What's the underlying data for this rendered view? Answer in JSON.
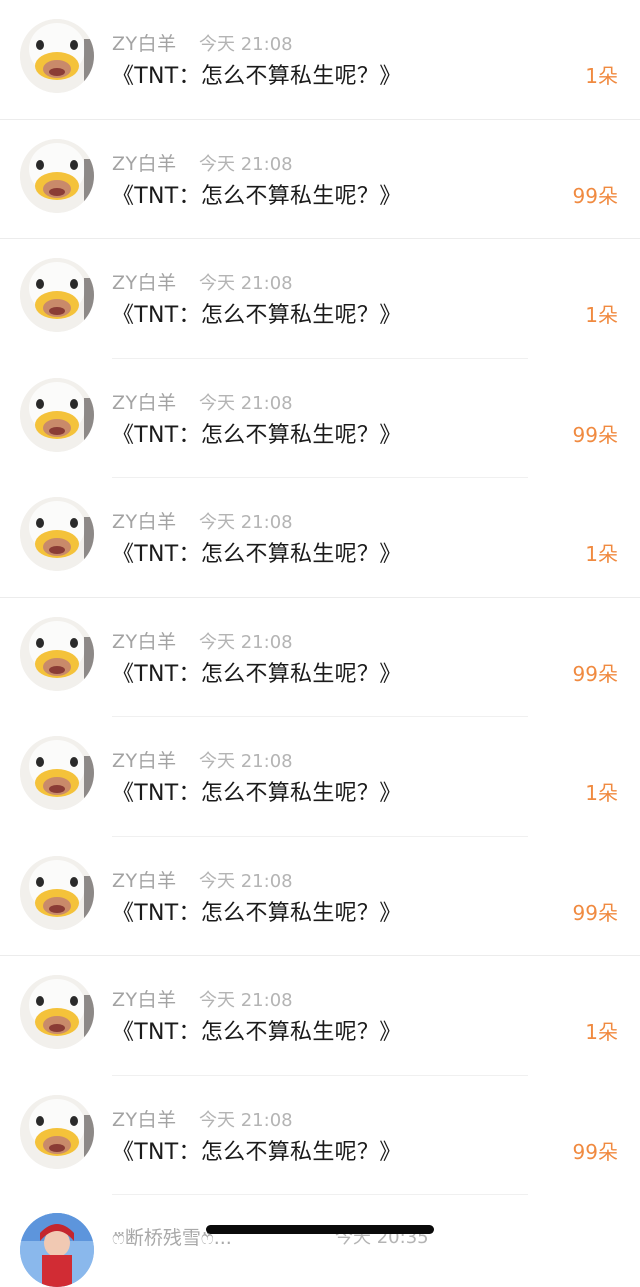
{
  "messages": [
    {
      "name": "ZY白羊",
      "time": "今天 21:08",
      "text": "《TNT：怎么不算私生呢？》",
      "gift": "1朵"
    },
    {
      "name": "ZY白羊",
      "time": "今天 21:08",
      "text": "《TNT：怎么不算私生呢？》",
      "gift": "99朵"
    },
    {
      "name": "ZY白羊",
      "time": "今天 21:08",
      "text": "《TNT：怎么不算私生呢？》",
      "gift": "1朵"
    },
    {
      "name": "ZY白羊",
      "time": "今天 21:08",
      "text": "《TNT：怎么不算私生呢？》",
      "gift": "99朵"
    },
    {
      "name": "ZY白羊",
      "time": "今天 21:08",
      "text": "《TNT：怎么不算私生呢？》",
      "gift": "1朵"
    },
    {
      "name": "ZY白羊",
      "time": "今天 21:08",
      "text": "《TNT：怎么不算私生呢？》",
      "gift": "99朵"
    },
    {
      "name": "ZY白羊",
      "time": "今天 21:08",
      "text": "《TNT：怎么不算私生呢？》",
      "gift": "1朵"
    },
    {
      "name": "ZY白羊",
      "time": "今天 21:08",
      "text": "《TNT：怎么不算私生呢？》",
      "gift": "99朵"
    },
    {
      "name": "ZY白羊",
      "time": "今天 21:08",
      "text": "《TNT：怎么不算私生呢？》",
      "gift": "1朵"
    },
    {
      "name": "ZY白羊",
      "time": "今天 21:08",
      "text": "《TNT：怎么不算私生呢？》",
      "gift": "99朵"
    }
  ],
  "last_item": {
    "name": "ෆ⃛断桥残雪ෆ⃛...",
    "time": "今天 20:35"
  },
  "colors": {
    "gift": "#f08a40",
    "name": "#a3a3a3",
    "text": "#1b1b1b"
  },
  "icons": {
    "avatar": "duck-costume-avatar-icon",
    "last_avatar": "user-avatar-icon"
  }
}
